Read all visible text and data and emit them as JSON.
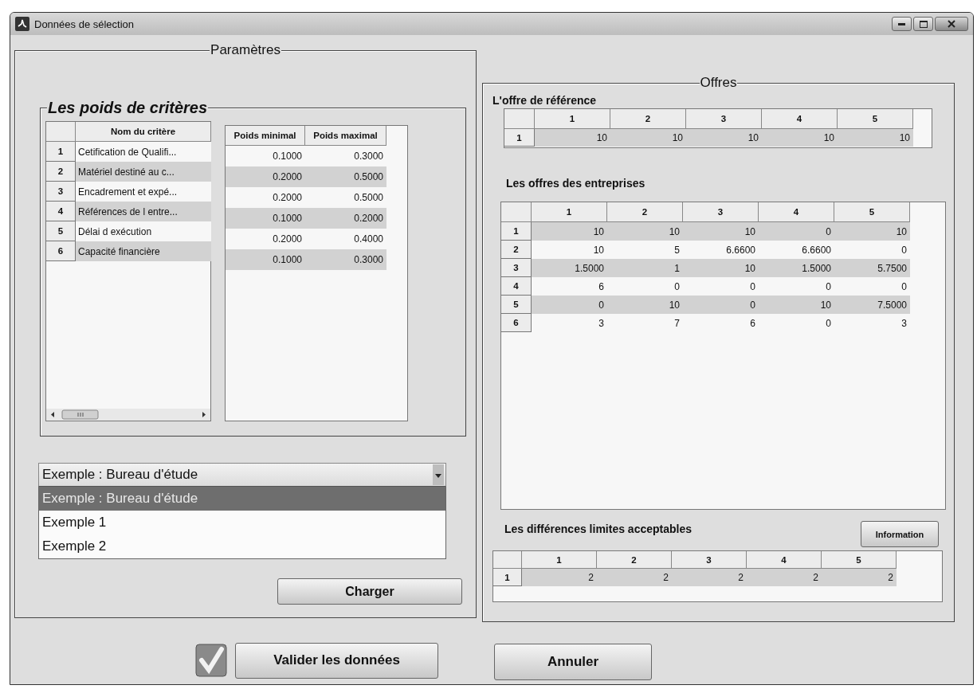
{
  "window": {
    "title": "Données de sélection"
  },
  "parametres": {
    "title": "Paramètres",
    "weights": {
      "title": "Les poids de critères",
      "criteria_table": {
        "columns": [
          "Nom du critère"
        ],
        "rows": [
          {
            "index": "1",
            "cells": [
              "Cetification de Qualifi..."
            ]
          },
          {
            "index": "2",
            "cells": [
              "Matériel destiné au c..."
            ]
          },
          {
            "index": "3",
            "cells": [
              "Encadrement et expé..."
            ]
          },
          {
            "index": "4",
            "cells": [
              "Références de l entre..."
            ]
          },
          {
            "index": "5",
            "cells": [
              "Délai d exécution"
            ]
          },
          {
            "index": "6",
            "cells": [
              "Capacité financière"
            ]
          }
        ]
      },
      "bounds_table": {
        "columns": [
          "Poids minimal",
          "Poids maximal"
        ],
        "rows": [
          {
            "cells": [
              "0.1000",
              "0.3000"
            ]
          },
          {
            "cells": [
              "0.2000",
              "0.5000"
            ]
          },
          {
            "cells": [
              "0.2000",
              "0.5000"
            ]
          },
          {
            "cells": [
              "0.1000",
              "0.2000"
            ]
          },
          {
            "cells": [
              "0.2000",
              "0.4000"
            ]
          },
          {
            "cells": [
              "0.1000",
              "0.3000"
            ]
          }
        ]
      }
    },
    "example_select": {
      "value": "Exemple : Bureau d'étude",
      "expanded": true,
      "options": [
        {
          "label": "Exemple : Bureau d'étude",
          "selected": true
        },
        {
          "label": "Exemple 1",
          "selected": false
        },
        {
          "label": "Exemple 2",
          "selected": false
        }
      ]
    },
    "load_button": "Charger"
  },
  "offres": {
    "title": "Offres",
    "reference": {
      "title": "L'offre de référence",
      "table": {
        "columns": [
          "1",
          "2",
          "3",
          "4",
          "5"
        ],
        "rows": [
          {
            "index": "1",
            "cells": [
              "10",
              "10",
              "10",
              "10",
              "10"
            ]
          }
        ]
      }
    },
    "companies": {
      "title": "Les offres des entreprises",
      "table": {
        "columns": [
          "1",
          "2",
          "3",
          "4",
          "5"
        ],
        "rows": [
          {
            "index": "1",
            "cells": [
              "10",
              "10",
              "10",
              "0",
              "10"
            ]
          },
          {
            "index": "2",
            "cells": [
              "10",
              "5",
              "6.6600",
              "6.6600",
              "0"
            ]
          },
          {
            "index": "3",
            "cells": [
              "1.5000",
              "1",
              "10",
              "1.5000",
              "5.7500"
            ]
          },
          {
            "index": "4",
            "cells": [
              "6",
              "0",
              "0",
              "0",
              "0"
            ]
          },
          {
            "index": "5",
            "cells": [
              "0",
              "10",
              "0",
              "10",
              "7.5000"
            ]
          },
          {
            "index": "6",
            "cells": [
              "3",
              "7",
              "6",
              "0",
              "3"
            ]
          }
        ]
      }
    },
    "differences": {
      "title": "Les différences limites acceptables",
      "info_button": "Information",
      "table": {
        "columns": [
          "1",
          "2",
          "3",
          "4",
          "5"
        ],
        "rows": [
          {
            "index": "1",
            "cells": [
              "2",
              "2",
              "2",
              "2",
              "2"
            ]
          }
        ]
      }
    }
  },
  "buttons": [
    {
      "kind": "confirm",
      "label": "Valider les données"
    },
    {
      "kind": "cancel",
      "label": "Annuler"
    }
  ]
}
